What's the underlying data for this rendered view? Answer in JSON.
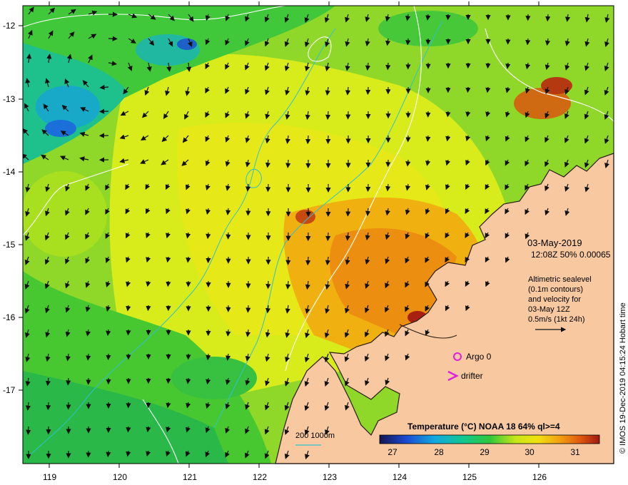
{
  "map": {
    "date": "03-May-2019",
    "pass_info": "12:08Z  50% 0.00065",
    "altimetry_text": [
      "Altimetric sealevel",
      "(0.1m contours)",
      "and velocity for",
      "03-May 12Z",
      "0.5m/s (1kt 24h)"
    ],
    "argo_label": "Argo 0",
    "drifter_label": "drifter",
    "bathymetry_legend": "200  1000m",
    "credit": "© IMOS 19-Dec-2019 04:15:24 Hobart time",
    "x_ticks": [
      "119",
      "120",
      "121",
      "122",
      "123",
      "124",
      "125",
      "126"
    ],
    "y_ticks": [
      "-12",
      "-13",
      "-14",
      "-15",
      "-16",
      "-17"
    ],
    "colorbar": {
      "title": "Temperature (°C) NOAA 18 64% ql>=4",
      "ticks": [
        "27",
        "28",
        "29",
        "30",
        "31"
      ],
      "range": [
        26.6,
        31.8
      ]
    },
    "colors": {
      "land": "#f8c9a1",
      "argo_marker": "#e020e0",
      "drifter_marker": "#e020e0",
      "bathymetry_contour": "#30c0d0",
      "sealevel_contour": "#ffffff"
    }
  }
}
